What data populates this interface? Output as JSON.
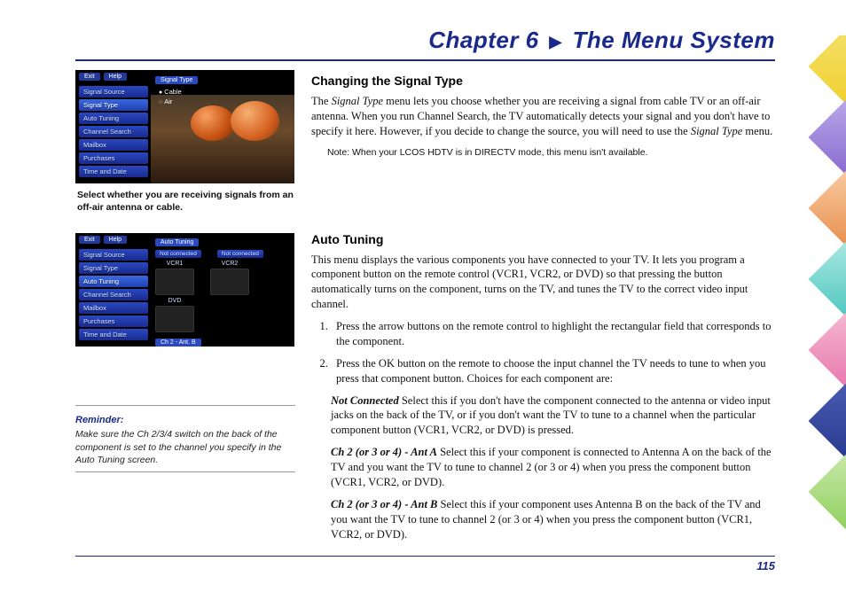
{
  "chapter_prefix": "Chapter 6",
  "chapter_title": "The Menu System",
  "page_number": "115",
  "screenshot1": {
    "menubar": {
      "exit": "Exit",
      "help": "Help"
    },
    "panel_title": "Signal Type",
    "opt_cable": "Cable",
    "opt_air": "Air",
    "menu": {
      "signal_source": "Signal Source",
      "signal_type": "Signal Type",
      "auto_tuning": "Auto Tuning",
      "channel_search": "Channel Search",
      "mailbox": "Mailbox",
      "purchases": "Purchases",
      "time_date": "Time and Date"
    },
    "caption": "Select whether you are receiving signals from an off-air antenna or cable."
  },
  "screenshot2": {
    "menubar": {
      "exit": "Exit",
      "help": "Help"
    },
    "panel_title": "Auto Tuning",
    "slot_nc1": "Not connected",
    "slot_nc2": "Not connected",
    "lbl_vcr1": "VCR1",
    "lbl_vcr2": "VCR2",
    "lbl_dvd": "DVD",
    "sel_bar": "Ch 2 - Ant. B",
    "menu": {
      "signal_source": "Signal Source",
      "signal_type": "Signal Type",
      "auto_tuning": "Auto Tuning",
      "channel_search": "Channel Search",
      "mailbox": "Mailbox",
      "purchases": "Purchases",
      "time_date": "Time and Date"
    }
  },
  "reminder": {
    "title": "Reminder:",
    "text": "Make sure the Ch 2/3/4 switch on the back of the component is set to the channel you specify in the Auto Tuning screen."
  },
  "section1": {
    "title": "Changing the Signal Type",
    "para_lead": "The ",
    "para_em1": "Signal Type",
    "para_mid": " menu lets you choose whether you are receiving a signal from cable TV or an off-air antenna. When you run Channel Search, the TV automatically detects your signal and you don't have to specify it here. However, if you decide to change the source, you will need to use the ",
    "para_em2": "Signal Type",
    "para_end": " menu.",
    "note": "Note: When your LCOS HDTV is in DIRECTV mode, this menu isn't available."
  },
  "section2": {
    "title": "Auto Tuning",
    "intro": "This menu displays the various components you have connected to your TV. It lets you program a component button on the remote control (VCR1, VCR2, or DVD) so that pressing the button automatically turns on the component, turns on the TV, and tunes the TV to the correct video input channel.",
    "step1": "Press the arrow buttons on the remote control to highlight the rectangular field that corresponds to the component.",
    "step2": "Press the OK button on the remote to choose the input channel the TV needs to tune to when you press that component button. Choices for each component are:",
    "opt_nc_term": "Not Connected",
    "opt_nc_text": "    Select this if you don't have the component connected to the antenna or video input jacks on the back of the TV, or if you don't want the TV to tune to a channel when the particular component button (VCR1, VCR2, or DVD) is pressed.",
    "opt_a_term": "Ch 2 (or 3 or 4) - Ant A",
    "opt_a_text": "    Select this if your component is connected to Antenna A on the back of the TV and you want the TV to tune to channel 2 (or 3 or 4) when you press the component button (VCR1, VCR2, or DVD).",
    "opt_b_term": "Ch 2 (or 3 or 4) - Ant B",
    "opt_b_text": "    Select this if your component uses Antenna B on the back of the TV and you want the TV to tune to channel 2 (or 3 or 4) when you press the component button (VCR1, VCR2, or DVD)."
  }
}
